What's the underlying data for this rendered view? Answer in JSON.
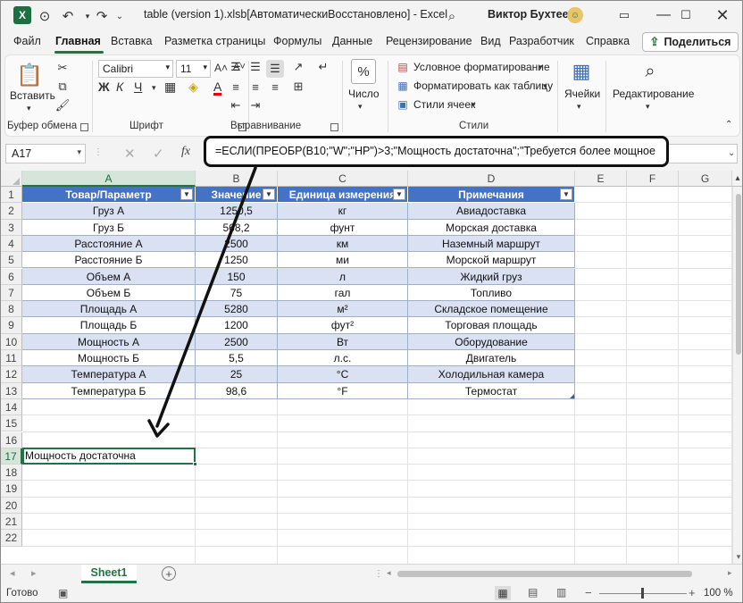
{
  "title": {
    "file_title": "table (version 1).xlsb[АвтоматическиВосстановлено] - Excel",
    "user_name": "Виктор Бухтеев"
  },
  "menu": {
    "items": [
      "Файл",
      "Главная",
      "Вставка",
      "Разметка страницы",
      "Формулы",
      "Данные",
      "Рецензирование",
      "Вид",
      "Разработчик",
      "Справка"
    ],
    "active": "Главная",
    "share_label": "Поделиться"
  },
  "ribbon": {
    "clipboard": {
      "paste_label": "Вставить",
      "group_label": "Буфер обмена"
    },
    "font": {
      "font_name": "Calibri",
      "font_size": "11",
      "group_label": "Шрифт"
    },
    "alignment": {
      "group_label": "Выравнивание"
    },
    "number": {
      "label": "Число"
    },
    "styles": {
      "conditional": "Условное форматирование",
      "as_table": "Форматировать как таблицу",
      "cell_styles": "Стили ячеек",
      "group_label": "Стили"
    },
    "cells": {
      "label": "Ячейки"
    },
    "editing": {
      "label": "Редактирование"
    }
  },
  "formula_bar": {
    "name_box": "A17",
    "formula": "=ЕСЛИ(ПРЕОБР(B10;\"W\";\"HP\")>3;\"Мощность достаточна\";\"Требуется более мощное"
  },
  "grid": {
    "columns": [
      "A",
      "B",
      "C",
      "D",
      "E",
      "F",
      "G"
    ],
    "rows": [
      "1",
      "2",
      "3",
      "4",
      "5",
      "6",
      "7",
      "8",
      "9",
      "10",
      "11",
      "12",
      "13",
      "14",
      "15",
      "16",
      "17",
      "18",
      "19",
      "20",
      "21",
      "22"
    ],
    "table_headers": [
      "Товар/Параметр",
      "Значение",
      "Единица измерения",
      "Примечания"
    ],
    "table_rows": [
      [
        "Груз А",
        "1250,5",
        "кг",
        "Авиадоставка"
      ],
      [
        "Груз Б",
        "568,2",
        "фунт",
        "Морская доставка"
      ],
      [
        "Расстояние А",
        "2500",
        "км",
        "Наземный маршрут"
      ],
      [
        "Расстояние Б",
        "1250",
        "ми",
        "Морской маршрут"
      ],
      [
        "Объем А",
        "150",
        "л",
        "Жидкий груз"
      ],
      [
        "Объем Б",
        "75",
        "гал",
        "Топливо"
      ],
      [
        "Площадь А",
        "5280",
        "м²",
        "Складское помещение"
      ],
      [
        "Площадь Б",
        "1200",
        "фут²",
        "Торговая площадь"
      ],
      [
        "Мощность А",
        "2500",
        "Вт",
        "Оборудование"
      ],
      [
        "Мощность Б",
        "5,5",
        "л.с.",
        "Двигатель"
      ],
      [
        "Температура А",
        "25",
        "°C",
        "Холодильная камера"
      ],
      [
        "Температура Б",
        "98,6",
        "°F",
        "Термостат"
      ]
    ],
    "active_cell_value": "Мощность достаточна"
  },
  "sheets": {
    "tabs": [
      "Sheet1"
    ]
  },
  "status": {
    "ready": "Готово",
    "zoom": "100 %"
  },
  "colors": {
    "accent": "#217346",
    "table_header": "#4472c4",
    "band_light": "#d9e1f2",
    "band_white": "#ffffff"
  }
}
